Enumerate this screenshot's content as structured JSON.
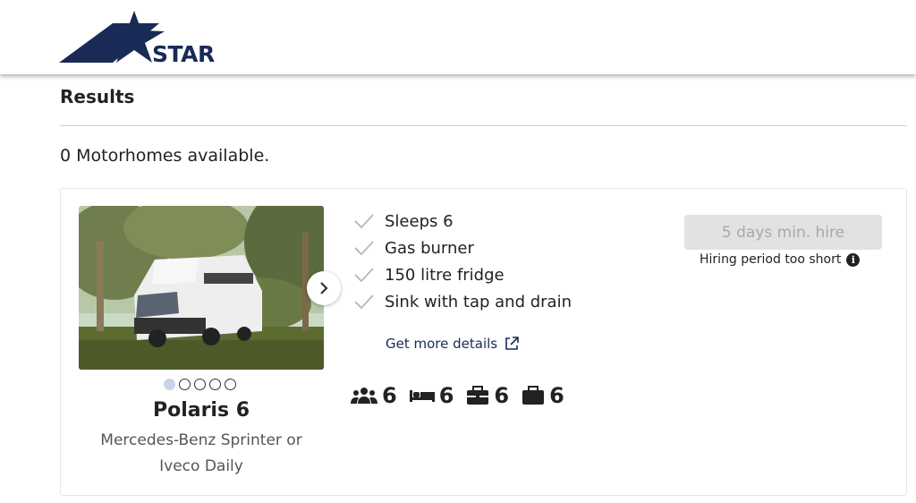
{
  "header": {
    "logo_text": "STAR"
  },
  "results": {
    "title": "Results",
    "count_text": "0 Motorhomes available."
  },
  "vehicle": {
    "name": "Polaris 6",
    "subtitle": "Mercedes-Benz Sprinter or Iveco Daily",
    "carousel": {
      "total": 5,
      "active": 1
    },
    "features": [
      "Sleeps 6",
      "Gas burner",
      "150 litre fridge",
      "Sink with tap and drain"
    ],
    "details_link": "Get more details",
    "specs": [
      {
        "icon": "people-icon",
        "value": "6"
      },
      {
        "icon": "bed-icon",
        "value": "6"
      },
      {
        "icon": "suitcase-icon",
        "value": "6"
      },
      {
        "icon": "bag-icon",
        "value": "6"
      }
    ],
    "hire_button": "5 days min. hire",
    "hire_note": "Hiring period too short",
    "info_glyph": "i"
  },
  "colors": {
    "brand": "#1a2a57",
    "check": "#b9bcc2",
    "disabled_bg": "#e2e2e2",
    "disabled_text": "#a8a8a8"
  }
}
